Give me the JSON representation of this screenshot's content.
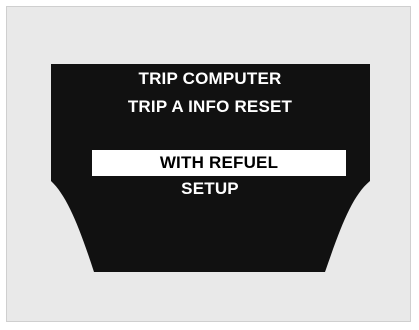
{
  "display": {
    "title_line_1": "TRIP COMPUTER",
    "title_line_2": "TRIP A INFO RESET",
    "menu_items": [
      {
        "label": "WITH REFUEL",
        "selected": true
      },
      {
        "label": "SETUP",
        "selected": false
      }
    ]
  },
  "colors": {
    "screen": "#111111",
    "text": "#ffffff",
    "highlight": "#ffffff",
    "highlight_text": "#000000",
    "background": "#e9e9e9"
  }
}
